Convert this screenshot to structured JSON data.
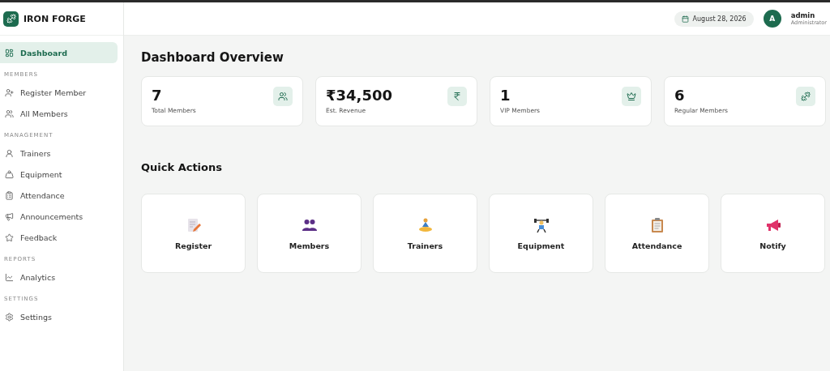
{
  "brand": {
    "name": "IRON FORGE"
  },
  "sidebar": {
    "items": [
      {
        "kind": "link",
        "label": "Dashboard",
        "selected": true
      },
      {
        "kind": "section",
        "label": "MEMBERS"
      },
      {
        "kind": "link",
        "label": "Register Member",
        "selected": false
      },
      {
        "kind": "link",
        "label": "All Members",
        "selected": false
      },
      {
        "kind": "section",
        "label": "MANAGEMENT"
      },
      {
        "kind": "link",
        "label": "Trainers",
        "selected": false
      },
      {
        "kind": "link",
        "label": "Equipment",
        "selected": false
      },
      {
        "kind": "link",
        "label": "Attendance",
        "selected": false
      },
      {
        "kind": "link",
        "label": "Announcements",
        "selected": false
      },
      {
        "kind": "link",
        "label": "Feedback",
        "selected": false
      },
      {
        "kind": "section",
        "label": "REPORTS"
      },
      {
        "kind": "link",
        "label": "Analytics",
        "selected": false
      },
      {
        "kind": "section",
        "label": "SETTINGS"
      },
      {
        "kind": "link",
        "label": "Settings",
        "selected": false
      }
    ]
  },
  "header": {
    "date": "August 28, 2026",
    "user": {
      "initial": "A",
      "name": "admin",
      "role": "Administrator"
    }
  },
  "title": "Dashboard Overview",
  "stats": [
    {
      "value": "7",
      "label": "Total Members"
    },
    {
      "value": "₹34,500",
      "label": "Est. Revenue"
    },
    {
      "value": "1",
      "label": "VIP Members"
    },
    {
      "value": "6",
      "label": "Regular Members"
    }
  ],
  "quick_actions_title": "Quick Actions",
  "quick_actions": [
    {
      "label": "Register"
    },
    {
      "label": "Members"
    },
    {
      "label": "Trainers"
    },
    {
      "label": "Equipment"
    },
    {
      "label": "Attendance"
    },
    {
      "label": "Notify"
    }
  ]
}
